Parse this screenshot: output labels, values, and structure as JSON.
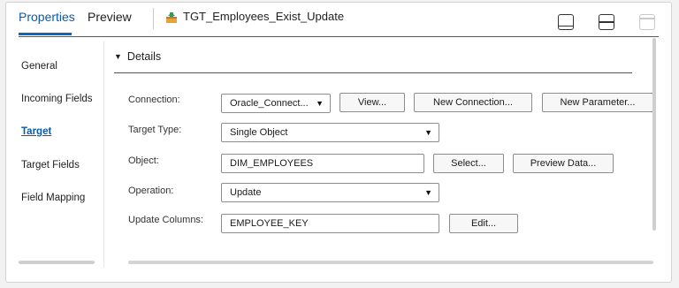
{
  "tabs": [
    {
      "label": "Properties",
      "active": true
    },
    {
      "label": "Preview",
      "active": false
    }
  ],
  "object_title": "TGT_Employees_Exist_Update",
  "layout_buttons": [
    "bottom-panel-icon",
    "split-panel-icon",
    "top-panel-icon"
  ],
  "sidebar": {
    "items": [
      {
        "label": "General"
      },
      {
        "label": "Incoming Fields"
      },
      {
        "label": "Target",
        "active": true
      },
      {
        "label": "Target Fields"
      },
      {
        "label": "Field Mapping"
      }
    ]
  },
  "details": {
    "header": "Details",
    "connection": {
      "label": "Connection:",
      "value": "Oracle_Connect...",
      "view_btn": "View...",
      "new_connection_btn": "New Connection...",
      "new_parameter_btn": "New Parameter..."
    },
    "target_type": {
      "label": "Target Type:",
      "value": "Single Object"
    },
    "object": {
      "label": "Object:",
      "value": "DIM_EMPLOYEES",
      "select_btn": "Select...",
      "preview_btn": "Preview Data..."
    },
    "operation": {
      "label": "Operation:",
      "value": "Update"
    },
    "update_columns": {
      "label": "Update Columns:",
      "value": "EMPLOYEE_KEY",
      "edit_btn": "Edit..."
    }
  },
  "colors": {
    "accent": "#0b66c3",
    "active_text": "#0c5aa8"
  }
}
